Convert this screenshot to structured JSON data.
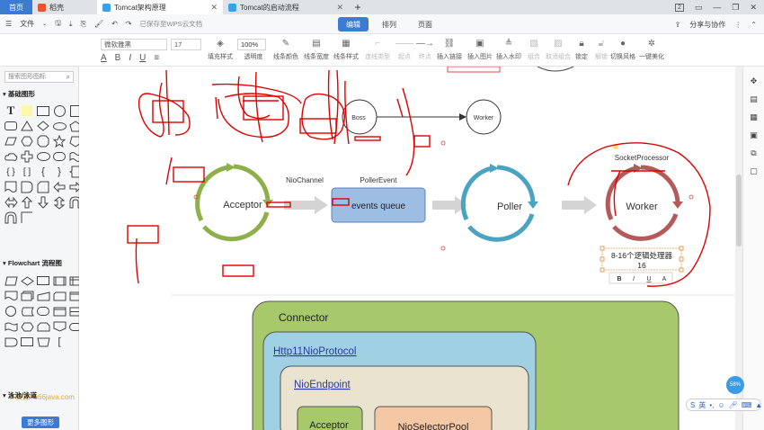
{
  "tabs": [
    {
      "label": "首页"
    },
    {
      "label": "稻壳"
    },
    {
      "label": "Tomcat架构原理"
    },
    {
      "label": "Tomcat的启动流程"
    }
  ],
  "window": {
    "badge": "2"
  },
  "menu": {
    "file_label": "文件",
    "saved_text": "已保存至WPS云文档",
    "mode_tabs": [
      "编辑",
      "排列",
      "页面"
    ],
    "share_label": "分享与协作"
  },
  "format": {
    "font_name": "微软雅黑",
    "font_size": "17",
    "zoom": "100%",
    "format_glyphs": [
      "A",
      "B",
      "I",
      "U",
      "≡"
    ]
  },
  "toolbar": [
    {
      "label": "填充样式",
      "enabled": true
    },
    {
      "label": "透明度",
      "enabled": true
    },
    {
      "label": "线条颜色",
      "enabled": true
    },
    {
      "label": "线条宽度",
      "enabled": true
    },
    {
      "label": "线条样式",
      "enabled": true
    },
    {
      "label": "连线类型",
      "enabled": false
    },
    {
      "label": "起点",
      "enabled": false
    },
    {
      "label": "终点",
      "enabled": false
    },
    {
      "label": "插入链接",
      "enabled": true
    },
    {
      "label": "插入图片",
      "enabled": true
    },
    {
      "label": "插入水印",
      "enabled": true
    },
    {
      "label": "组合",
      "enabled": false
    },
    {
      "label": "取消组合",
      "enabled": false
    },
    {
      "label": "锁定",
      "enabled": true
    },
    {
      "label": "解锁",
      "enabled": false
    },
    {
      "label": "切换风格",
      "enabled": true
    },
    {
      "label": "一键美化",
      "enabled": true
    }
  ],
  "sidebar": {
    "search_placeholder": "搜索图形图标",
    "section_basic": "基础图形",
    "section_flowchart": "Flowchart 流程图",
    "section_swimlane": "泳池/泳道",
    "more_button": "更多图形",
    "watermark": "IT资源: 666java.com"
  },
  "diagram": {
    "top": {
      "boss": "Boss",
      "worker": "Worker"
    },
    "acceptor": "Acceptor",
    "nio_channel": "NioChannel",
    "poller_event": "PollerEvent",
    "events_queue": "events queue",
    "poller": "Poller",
    "worker": "Worker",
    "socket_processor": "SocketProcessor",
    "worker_note": "8-16个逻辑处理器",
    "worker_count": "16",
    "mini_format": [
      "B",
      "I",
      "U",
      "A"
    ],
    "connector": "Connector",
    "protocol": "Http11NioProtocol",
    "endpoint": "NioEndpoint",
    "bottom_acceptor": "Acceptor",
    "bottom_selector": "NioSelectorPool"
  },
  "ime": {
    "label": "英"
  },
  "bubble": {
    "label": "58%"
  },
  "colors": {
    "accent": "#3b7bd6",
    "acceptor": "#8db04a",
    "poller": "#4aa3c0",
    "worker": "#b55a5a",
    "connector_fill": "#a8c96b",
    "protocol_fill": "#9fd0e3",
    "endpoint_fill": "#e9e3cf",
    "annotation": "#e00000"
  }
}
